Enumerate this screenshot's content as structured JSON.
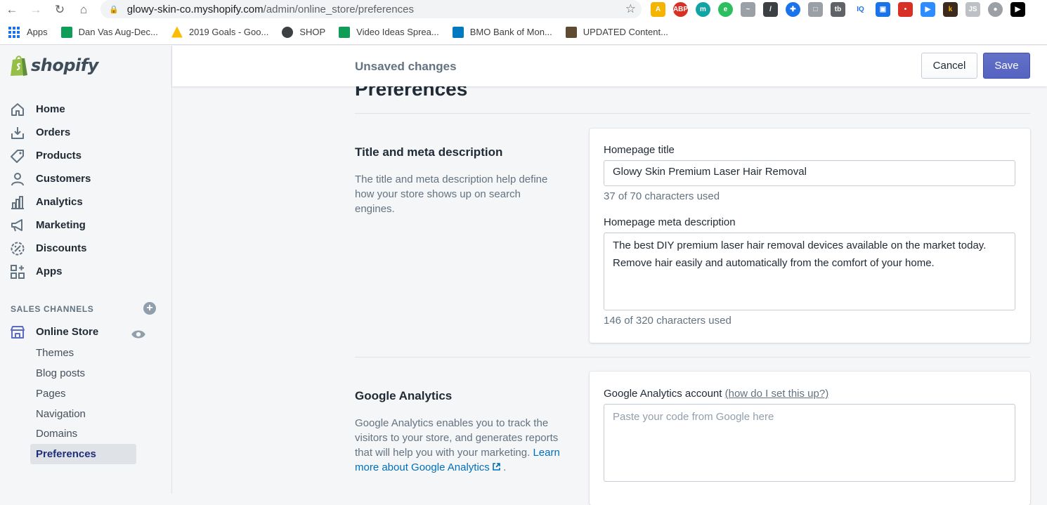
{
  "browser": {
    "url_host": "glowy-skin-co.myshopify.com",
    "url_path": "/admin/online_store/preferences",
    "bookmarks": [
      {
        "label": "Apps",
        "color": "#1a73e8"
      },
      {
        "label": "Dan Vas Aug-Dec...",
        "color": "#0f9d58"
      },
      {
        "label": "2019 Goals - Goo...",
        "color": "#fbbc04"
      },
      {
        "label": "SHOP",
        "color": "#3c4043"
      },
      {
        "label": "Video Ideas Sprea...",
        "color": "#0f9d58"
      },
      {
        "label": "BMO Bank of Mon...",
        "color": "#0079c1"
      },
      {
        "label": "UPDATED Content...",
        "color": "#5f4b32"
      }
    ]
  },
  "sidebar": {
    "logo_text": "shopify",
    "items": [
      {
        "label": "Home",
        "icon": "home-icon"
      },
      {
        "label": "Orders",
        "icon": "orders-icon"
      },
      {
        "label": "Products",
        "icon": "tag-icon"
      },
      {
        "label": "Customers",
        "icon": "person-icon"
      },
      {
        "label": "Analytics",
        "icon": "bar-chart-icon"
      },
      {
        "label": "Marketing",
        "icon": "megaphone-icon"
      },
      {
        "label": "Discounts",
        "icon": "discount-icon"
      },
      {
        "label": "Apps",
        "icon": "apps-icon"
      }
    ],
    "sales_channels_title": "SALES CHANNELS",
    "online_store_label": "Online Store",
    "sub_items": [
      "Themes",
      "Blog posts",
      "Pages",
      "Navigation",
      "Domains",
      "Preferences"
    ],
    "active_sub_item": "Preferences"
  },
  "topbar": {
    "unsaved_text": "Unsaved changes",
    "cancel_label": "Cancel",
    "save_label": "Save"
  },
  "page": {
    "title": "Preferences"
  },
  "title_meta": {
    "heading": "Title and meta description",
    "description": "The title and meta description help define how your store shows up on search engines.",
    "homepage_title_label": "Homepage title",
    "homepage_title_value": "Glowy Skin Premium Laser Hair Removal",
    "homepage_title_count": "37 of 70 characters used",
    "meta_label": "Homepage meta description",
    "meta_value": "The best DIY premium laser hair removal devices available on the market today. Remove hair easily and automatically from the comfort of your home.",
    "meta_count": "146 of 320 characters used"
  },
  "analytics": {
    "heading": "Google Analytics",
    "description": "Google Analytics enables you to track the visitors to your store, and generates reports that will help you with your marketing.",
    "learn_more": "Learn more about Google Analytics",
    "period": ".",
    "account_label": "Google Analytics account",
    "help_link": "(how do I set this up?)",
    "placeholder": "Paste your code from Google here"
  },
  "colors": {
    "save_button": "#5c6ac4",
    "active_nav": "#202e78",
    "link": "#006fbb"
  }
}
